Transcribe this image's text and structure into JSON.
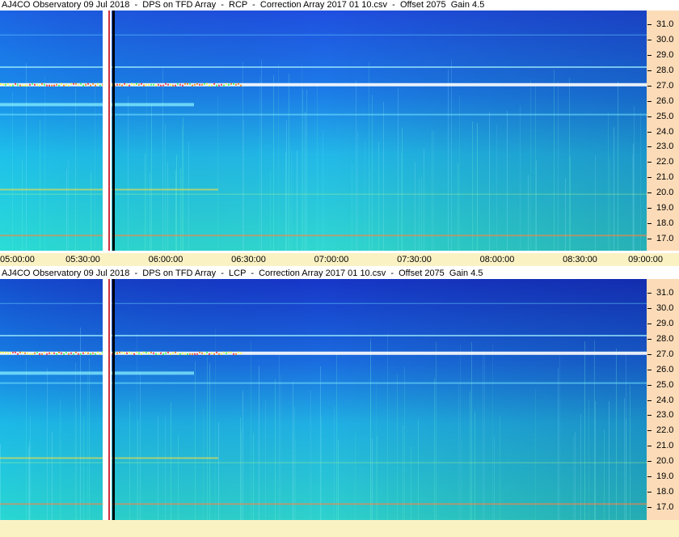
{
  "chart_data": [
    {
      "type": "heatmap",
      "title": "AJ4CO Observatory 09 Jul 2018  -  DPS on TFD Array  -  RCP  -  Correction Array 2017 01 10.csv  -  Offset 2075  Gain 4.5",
      "x_ticks": [
        "05:00:00",
        "05:30:00",
        "06:00:00",
        "06:30:00",
        "07:00:00",
        "07:30:00",
        "08:00:00",
        "08:30:00",
        "09:00:00"
      ],
      "y_ticks": [
        "31.0",
        "30.0",
        "29.0",
        "28.0",
        "27.0",
        "26.0",
        "25.0",
        "24.0",
        "23.0",
        "22.0",
        "21.0",
        "20.0",
        "19.0",
        "18.0",
        "17.0"
      ],
      "xlim": [
        "05:00:00",
        "09:00:00"
      ],
      "ylim": [
        16.5,
        31.5
      ],
      "colors": {
        "high_freq": "#1f4fe0",
        "mid_freq": "#1c7ee8",
        "low_freq": "#22b8e8",
        "bottom": "#30d8d0"
      }
    },
    {
      "type": "heatmap",
      "title": "AJ4CO Observatory 09 Jul 2018  -  DPS on TFD Array  -  LCP  -  Correction Array 2017 01 10.csv  -  Offset 2075  Gain 4.5",
      "x_ticks": [],
      "y_ticks": [
        "31.0",
        "30.0",
        "29.0",
        "28.0",
        "27.0",
        "26.0",
        "25.0",
        "24.0",
        "23.0",
        "22.0",
        "21.0",
        "20.0",
        "19.0",
        "18.0",
        "17.0"
      ],
      "xlim": [
        "05:00:00",
        "09:00:00"
      ],
      "ylim": [
        16.5,
        31.5
      ],
      "colors": {
        "high_freq": "#1736c8",
        "mid_freq": "#1a6ee0",
        "low_freq": "#20b0e4",
        "bottom": "#2ed2cc"
      }
    }
  ]
}
